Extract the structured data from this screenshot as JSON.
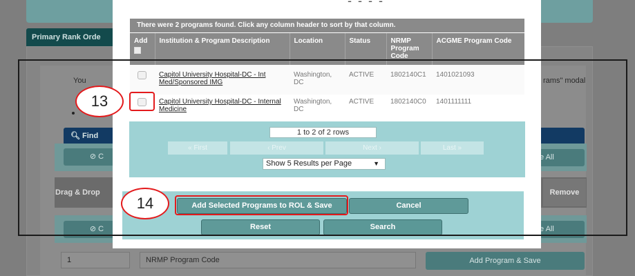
{
  "background": {
    "tab_label": "Primary Rank Orde",
    "instruction_left": "You",
    "instruction_right": "rams\" modal",
    "find_button": "Find",
    "find_icon": "search-icon",
    "clear_icon": "block-icon",
    "remove_all_right": "e All",
    "drag_drop_label": "Drag & Drop",
    "remove_label": "Remove",
    "rank_input_value": "1",
    "program_code_placeholder": "NRMP Program Code",
    "add_program_save": "Add Program & Save"
  },
  "modal": {
    "summary": "There were 2 programs found. Click any column header to sort by that column.",
    "columns": [
      {
        "key": "add",
        "label": "Add"
      },
      {
        "key": "institution",
        "label": "Institution & Program Description"
      },
      {
        "key": "location",
        "label": "Location"
      },
      {
        "key": "status",
        "label": "Status"
      },
      {
        "key": "nrmp_code",
        "label": "NRMP Program Code"
      },
      {
        "key": "acgme_code",
        "label": "ACGME Program Code"
      }
    ],
    "rows": [
      {
        "institution": "Capitol University Hospital-DC - Int Med/Sponsored IMG",
        "location": "Washington, DC",
        "status": "ACTIVE",
        "nrmp_code": "1802140C1",
        "acgme_code": "1401021093"
      },
      {
        "institution": "Capitol University Hospital-DC - Internal Medicine",
        "location": "Washington, DC",
        "status": "ACTIVE",
        "nrmp_code": "1802140C0",
        "acgme_code": "1401111111"
      }
    ],
    "pager": {
      "count_text": "1 to 2 of 2 rows",
      "first": "« First",
      "prev": "‹ Prev",
      "next": "Next ›",
      "last": "Last »",
      "per_page_selected": "Show 5 Results per Page"
    },
    "footer": {
      "add_save": "Add Selected Programs to ROL & Save",
      "cancel": "Cancel",
      "reset": "Reset",
      "search": "Search"
    }
  },
  "annotations": {
    "step_13": "13",
    "step_14": "14",
    "highlight_color": "#e31a1c"
  }
}
